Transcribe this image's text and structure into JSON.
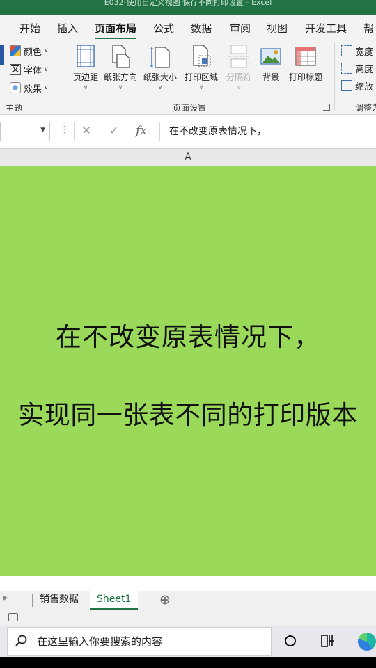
{
  "window": {
    "title": "E032-使用自定义视图 保存不同打印设置 - Excel"
  },
  "tabs": [
    {
      "label": "开始",
      "active": false
    },
    {
      "label": "插入",
      "active": false
    },
    {
      "label": "页面布局",
      "active": true
    },
    {
      "label": "公式",
      "active": false
    },
    {
      "label": "数据",
      "active": false
    },
    {
      "label": "审阅",
      "active": false
    },
    {
      "label": "视图",
      "active": false
    },
    {
      "label": "开发工具",
      "active": false
    },
    {
      "label": "帮",
      "active": false
    }
  ],
  "ribbon": {
    "theme_group": {
      "label": "主题",
      "items": [
        {
          "label": "颜色",
          "icon": "color-palette-icon"
        },
        {
          "label": "字体",
          "icon": "font-icon"
        },
        {
          "label": "效果",
          "icon": "effects-icon"
        }
      ]
    },
    "page_setup_group": {
      "label": "页面设置",
      "buttons": [
        {
          "label": "页边距",
          "icon": "margins-icon",
          "enabled": true
        },
        {
          "label": "纸张方向",
          "icon": "orientation-icon",
          "enabled": true
        },
        {
          "label": "纸张大小",
          "icon": "paper-size-icon",
          "enabled": true
        },
        {
          "label": "打印区域",
          "icon": "print-area-icon",
          "enabled": true
        },
        {
          "label": "分隔符",
          "icon": "breaks-icon",
          "enabled": false
        },
        {
          "label": "背景",
          "icon": "background-icon",
          "enabled": true
        },
        {
          "label": "打印标题",
          "icon": "print-titles-icon",
          "enabled": true
        }
      ]
    },
    "scale_group": {
      "label": "调整为",
      "items": [
        {
          "label": "宽度",
          "icon": "width-icon"
        },
        {
          "label": "高度",
          "icon": "height-icon"
        },
        {
          "label": "缩放",
          "icon": "scale-icon"
        }
      ]
    }
  },
  "formula_bar": {
    "cancel_symbol": "✕",
    "enter_symbol": "✓",
    "fx_symbol": "fx",
    "content": "在不改变原表情况下，"
  },
  "column_header": "A",
  "cell": {
    "line1": "在不改变原表情况下，",
    "line2": "实现同一张表不同的打印版本",
    "fill_color": "#9ad95a"
  },
  "sheets": [
    {
      "label": "销售数据",
      "active": false
    },
    {
      "label": "Sheet1",
      "active": true
    }
  ],
  "add_sheet_symbol": "⊕",
  "taskbar": {
    "search_placeholder": "在这里输入你要搜索的内容"
  },
  "colors": {
    "excel_green": "#217346"
  }
}
